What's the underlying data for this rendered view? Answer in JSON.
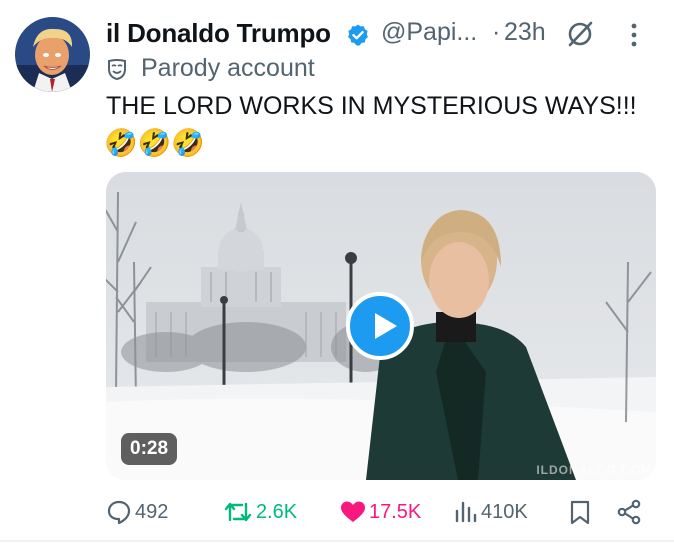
{
  "author": {
    "name": "il Donaldo Trumpo",
    "handle": "@Papi...",
    "time_sep": "·",
    "time": "23h",
    "label": "Parody account"
  },
  "tweet": {
    "text": "THE LORD WORKS IN MYSTERIOUS WAYS!!!",
    "emojis": "🤣🤣🤣"
  },
  "media": {
    "duration": "0:28",
    "watermark": "ILDONALDO.COM"
  },
  "actions": {
    "replies": "492",
    "reposts": "2.6K",
    "likes": "17.5K",
    "views": "410K"
  },
  "colors": {
    "verified": "#1d9bf0",
    "repost": "#00ba7c",
    "like": "#f91880",
    "muted": "#536471"
  }
}
